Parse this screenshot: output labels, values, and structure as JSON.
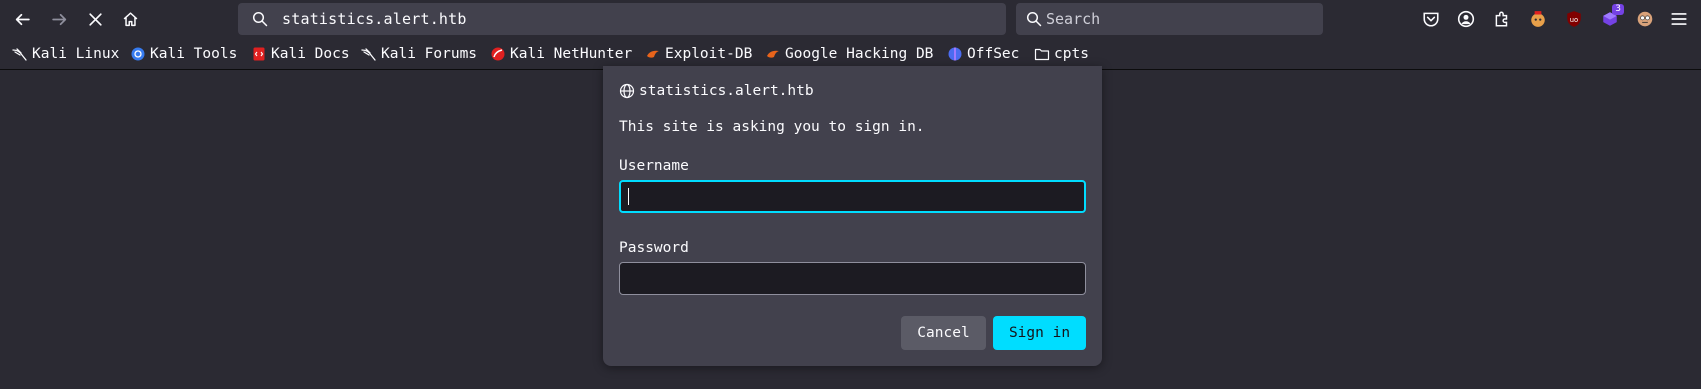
{
  "toolbar": {
    "url": "statistics.alert.htb",
    "search_placeholder": "Search",
    "extensions_badge": "3"
  },
  "bookmarks": [
    {
      "label": "Kali Linux",
      "icon": "kali-dragon-icon"
    },
    {
      "label": "Kali Tools",
      "icon": "kali-tools-icon"
    },
    {
      "label": "Kali Docs",
      "icon": "kali-docs-icon"
    },
    {
      "label": "Kali Forums",
      "icon": "kali-forums-icon"
    },
    {
      "label": "Kali NetHunter",
      "icon": "nethunter-icon"
    },
    {
      "label": "Exploit-DB",
      "icon": "exploit-db-icon"
    },
    {
      "label": "Google Hacking DB",
      "icon": "ghdb-icon"
    },
    {
      "label": "OffSec",
      "icon": "offsec-icon"
    },
    {
      "label": "cpts",
      "icon": "folder-icon"
    }
  ],
  "dialog": {
    "host": "statistics.alert.htb",
    "message": "This site is asking you to sign in.",
    "username_label": "Username",
    "username_value": "",
    "password_label": "Password",
    "password_value": "",
    "cancel_label": "Cancel",
    "signin_label": "Sign in"
  },
  "colors": {
    "accent": "#00ddff",
    "background": "#2b2a33",
    "panel": "#42414d"
  }
}
